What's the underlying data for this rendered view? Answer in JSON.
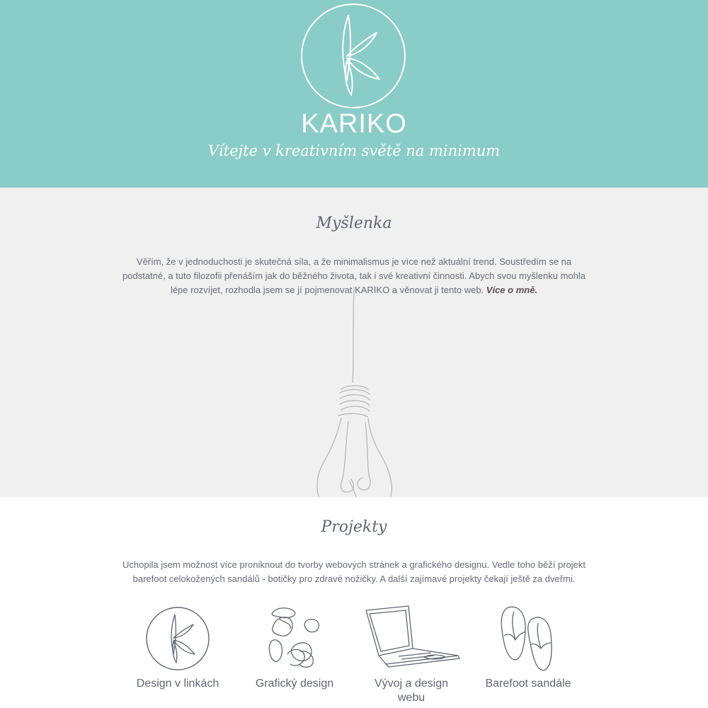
{
  "hero": {
    "brand": "KARIKO",
    "tagline": "Vítejte v kreativním světě na minimum"
  },
  "idea": {
    "title": "Myšlenka",
    "text": "Věřím, že v jednoduchosti je skutečná síla, a že minimalismus je více než aktuální trend. Soustředím se na podstatné, a tuto filozofii přenáším jak do běžného života, tak i své kreativní činnosti. Abych svou myšlenku mohla lépe rozvíjet, rozhodla jsem se jí pojmenovat KARIKO a věnovat ji tento web.",
    "link_label": "Více o mně."
  },
  "projects": {
    "title": "Projekty",
    "text": "Uchopila jsem možnost více proniknout do tvorby webových stránek a grafického designu. Vedle toho běží projekt barefoot celokožených sandálů - botičky pro zdravé nožičky. A další zajímavé projekty čekají ještě za dveřmi.",
    "items": [
      {
        "label": "Design v linkách",
        "icon": "kariko-logo-icon"
      },
      {
        "label": "Grafický design",
        "icon": "shapes-icon"
      },
      {
        "label": "Vývoj a design webu",
        "icon": "laptop-icon"
      },
      {
        "label": "Barefoot sandále",
        "icon": "sandals-icon"
      }
    ]
  },
  "colors": {
    "hero_bg": "#8accc8",
    "idea_bg": "#f0f0f0",
    "text": "#5f6672",
    "link": "#5d4a54"
  }
}
